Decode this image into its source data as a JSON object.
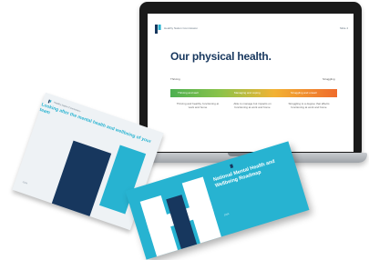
{
  "laptop_slide": {
    "logo_text": "Healthy Nation Commission",
    "page_number": "Slide 4",
    "title": "Our physical health.",
    "scale_left": "Thriving",
    "scale_right": "Struggling",
    "segments": [
      "Thriving and well",
      "Managing and coping",
      "Struggling and unwell"
    ],
    "descriptions": [
      "Thriving and healthy, functioning at work and home",
      "Able to manage but impacts on functioning at work and home",
      "Struggling to a degree that affects functioning at work and home"
    ],
    "colors": {
      "title": "#17375e",
      "gradient_start": "#4caf50",
      "gradient_end": "#ef6b2c"
    }
  },
  "brochure_back": {
    "logo_text": "Healthy Nation Commission",
    "title": "Looking after the mental health and wellbeing of your team",
    "footer": "2024"
  },
  "brochure_front": {
    "title": "National Mental Health and Wellbeing Roadmap",
    "footer": "2024"
  },
  "colors": {
    "navy": "#17375e",
    "cyan": "#27b3d1"
  }
}
